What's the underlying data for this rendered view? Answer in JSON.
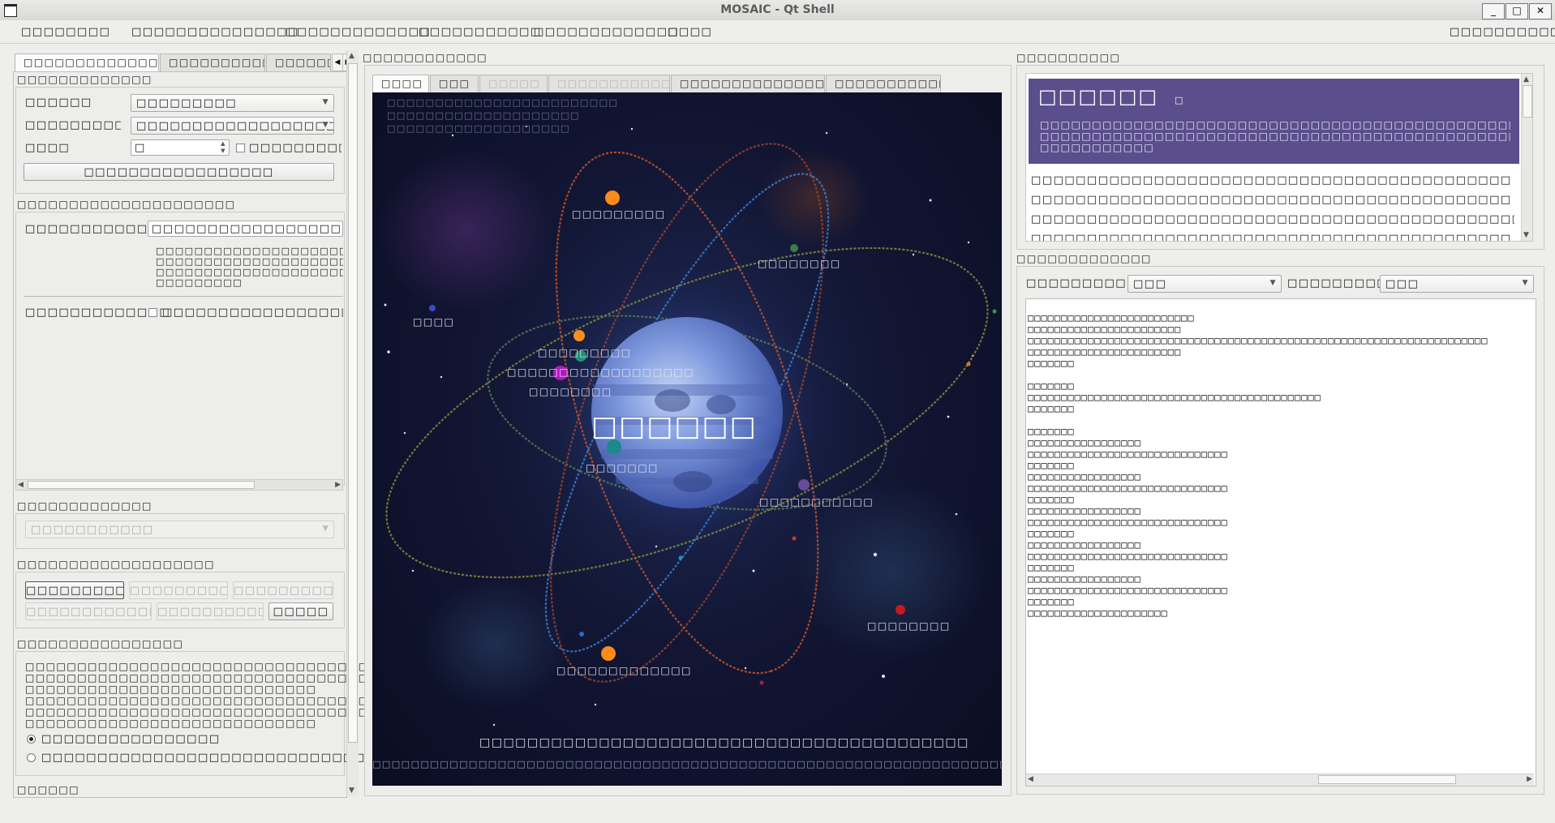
{
  "window": {
    "title": "MOSAIC - Qt Shell"
  },
  "menu": {
    "items": [
      "□□□□□□□□",
      "□□□□□□□□□□□□□□□",
      "□□□□□□□□□□□□□",
      "□□□□□□□□□□□",
      "□□□□□□□□□□□□□",
      "□□□□"
    ],
    "right": "□□□□□□□□□□□"
  },
  "left": {
    "tabs": [
      "□□□□□□□□□□□□□□□",
      "□□□□□□□□□□",
      "□□□□□□"
    ],
    "section1": {
      "title": "□□□□□□□□□□□□□",
      "row1_label": "□□□□□□",
      "row1_value": "□□□□□□□□□",
      "row2_label": "□□□□□□□□□□□",
      "row2_value": "□□□□□□□□□□□□□□□□□□□□□□□",
      "row3_label": "□□□□",
      "row3_value": "□",
      "row3_check_label": "□□□□□□□□□□",
      "button": "□□□□□□□□□□□□□□□□□"
    },
    "section2": {
      "title": "□□□□□□□□□□□□□□□□□□□□□",
      "label": "□□□□□□□□□□□",
      "value": "□□□□□□□□□□□□□□□□□□□□□□□□",
      "lines": [
        "□□□□□□□□□□□□□□□□□□□□□□□□□□□□",
        "□□□□□□□□□□□□□□□□□□□□□□□□□□□□",
        "□□□□□□□□□□□□□□□□□□□□□□□□□□□□",
        "□□□□□□□□□"
      ],
      "check_label_left": "□□□□□□□□□□□□□",
      "check_label_right": "□□□□□□□□□□□□□□□□□□□□□□"
    },
    "section3": {
      "title": "□□□□□□□□□□□□□",
      "combo": "□□□□□□□□□□□"
    },
    "section4": {
      "title": "□□□□□□□□□□□□□□□□□□□",
      "buttons": [
        "□□□□□□□□□□□",
        "□□□□□□□□□□□",
        "□□□□□□□□□□□",
        "□□□□□□□□□□□□□□□",
        "□□□□□□□□□□□",
        "□□□□□"
      ]
    },
    "section5": {
      "title": "□□□□□□□□□□□□□□□□",
      "lines": [
        "□□□□□□□□□□□□□□□□□□□□□□□□□□□□□□□□□□□",
        "□□□□□□□□□□□□□□□□□□□□□□□□□□□□□□□□□□□□□",
        "□□□□□□□□□□□□□□□□□□□□□□□□□□□□",
        "□□□□□□□□□□□□□□□□□□□□□□□□□□□□□□□□□",
        "□□□□□□□□□□□□□□□□□□□□□□□□□□□□□□□□□",
        "□□□□□□□□□□□□□□□□□□□□□□□□□□□□"
      ],
      "radio1": "□□□□□□□□□□□□□□□□",
      "radio2": "□□□□□□□□□□□□□□□□□□□□□□□□□□□□□□□□□□□"
    },
    "footer": "□□□□□□"
  },
  "center": {
    "title": "□□□□□□□□□□□□",
    "tabs": [
      "□□□□",
      "□□□",
      "□□□□□",
      "□□□□□□□□□□□□□",
      "□□□□□□□□□□□□□□□□",
      "□□□□□□□□□□□□"
    ],
    "overlay_lines": [
      "□□□□□□□□□□□□□□□□□□□□□□□□",
      "□□□□□□□□□□□□□□□□□□□□",
      "□□□□□□□□□□□□□□□□□□□"
    ],
    "center_label": "□□□□□□",
    "planet_labels": [
      "□□□□□□□□□",
      "□□□□□□□□",
      "□□□□",
      "□□□□□□□□□",
      "□□□□□□□□□□□□□□□□□□",
      "□□□□□□□□",
      "□□□□□□□",
      "□□□□□□□□□□□",
      "□□□□□□□□",
      "□□□□□□□□□□□□□"
    ],
    "bottom_line1": "□□□□□□□□□□□□□□□□□□□□□□□□□□□□□□□□□□□□□□□□□",
    "bottom_line2": "□□□□□□□□□□□□□□□□□□□□□□□□□□□□□□□□□□□□□□□□□□□□□□□□□□□□□□□□□□□□□□□□□□□□□□□□□□□□□□□□"
  },
  "right": {
    "top_title": "□□□□□□□□□□",
    "card": {
      "title": "□□□□□□",
      "sub": "□",
      "lines": [
        "□□□□□□□□□□□□□□□□□□□□□□□□□□□□□□□□□□□□□□□□□□□□□□□□□□□□□□□□□□□□□□□",
        "□□□□□□□□□□□□□□□□□□□□□□□□□□□□□□□□□□□□□□□□□□□□□□□□□□□□□□□□□□□□",
        "□□□□□□□□□□□"
      ]
    },
    "list": [
      "□□□□□□□□□□□□□□□□□□□□□□□□□□□□□□□□□□□□□□□□□□□□□□□□□□□□□□□□□□□□",
      "□□□□□□□□□□□□□□□□□□□□□□□□□□□□□□□□□□□□□□□□□□□□□□□□□□□□□□□□□□",
      "□□□□□□□□□□□□□□□□□□□□□□□□□□□□□□□□□□□□□□□□□□□□□□□□□□□□□□□□□□□□□□□□□□",
      "□□□□□□□□□□□□□□□□□□□□□□□□□□□□□□□□□□□□□□□□□□□□□□□□□□□□□□□□□□"
    ],
    "bottom_title": "□□□□□□□□□□□□□",
    "filter1_label": "□□□□□□□□□□□",
    "filter1_value": "□□□",
    "filter2_label": "□□□□□□□□□□",
    "filter2_value": "□□□",
    "log": "□□□□□□□□□□□□□□□□□□□□□□□□□\n□□□□□□□□□□□□□□□□□□□□□□□\n□□□□□□□□□□□□□□□□□□□□□□□□□□□□□□□□□□□□□□□□□□□□□□□□□□□□□□□□□□□□□□□□□□□□□\n□□□□□□□□□□□□□□□□□□□□□□□\n□□□□□□□\n\n□□□□□□□\n□□□□□□□□□□□□□□□□□□□□□□□□□□□□□□□□□□□□□□□□□□□□\n□□□□□□□\n\n□□□□□□□\n□□□□□□□□□□□□□□□□□\n□□□□□□□□□□□□□□□□□□□□□□□□□□□□□□\n□□□□□□□\n□□□□□□□□□□□□□□□□□\n□□□□□□□□□□□□□□□□□□□□□□□□□□□□□□\n□□□□□□□\n□□□□□□□□□□□□□□□□□\n□□□□□□□□□□□□□□□□□□□□□□□□□□□□□□\n□□□□□□□\n□□□□□□□□□□□□□□□□□\n□□□□□□□□□□□□□□□□□□□□□□□□□□□□□□\n□□□□□□□\n□□□□□□□□□□□□□□□□□\n□□□□□□□□□□□□□□□□□□□□□□□□□□□□□□\n□□□□□□□\n□□□□□□□□□□□□□□□□□□□□□"
  },
  "colors": {
    "card_bg": "#5a4e8c",
    "viewport_bg": "#121634",
    "orbit_orange": "#c8552c",
    "orbit_blue": "#3d7fd0",
    "orbit_olive": "#8a8a3a"
  }
}
